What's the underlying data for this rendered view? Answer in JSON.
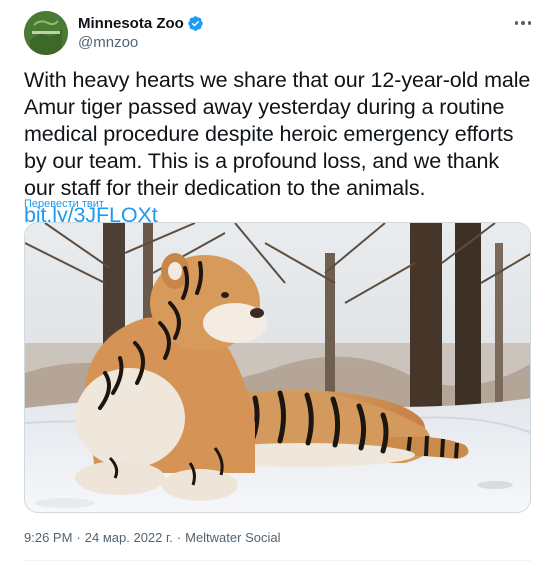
{
  "account": {
    "display_name": "Minnesota Zoo",
    "handle": "@mnzoo",
    "verified": true,
    "avatar_icon": "minnesota-zoo-logo"
  },
  "tweet": {
    "text": "With heavy hearts we share that our 12-year-old male Amur tiger passed away yesterday during a routine medical procedure despite heroic emergency efforts by our team. This is a profound loss, and we thank our staff for their dedication to the animals.",
    "link": "bit.ly/3JFLOXt",
    "translate_label": "Перевести твит"
  },
  "meta": {
    "time": "9:26 PM",
    "separator": "·",
    "date": "24 мар. 2022 г.",
    "source": "Meltwater Social"
  },
  "colors": {
    "link": "#1d9bf0",
    "muted": "#536471",
    "text": "#0f1419"
  },
  "icons": {
    "more": "more-horizontal-icon",
    "verified": "verified-badge-icon"
  }
}
